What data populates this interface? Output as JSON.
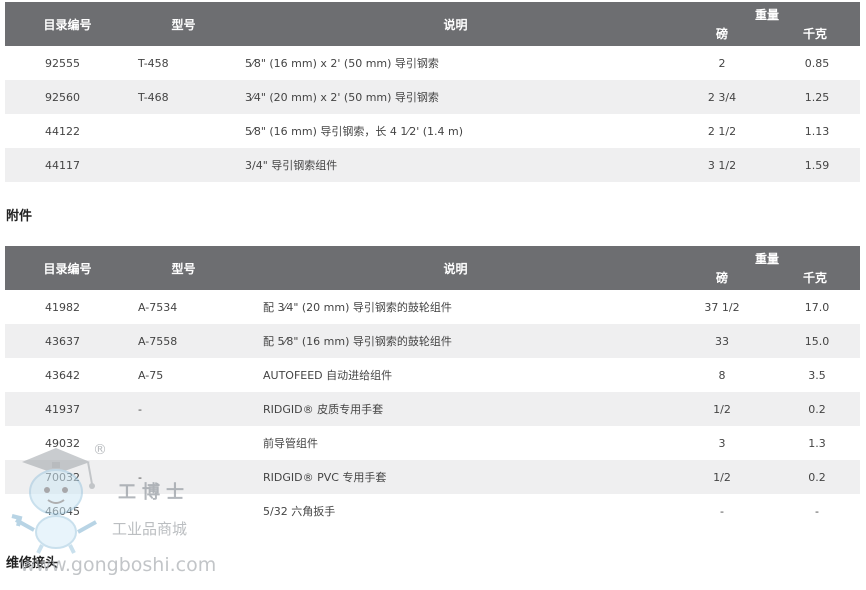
{
  "table1": {
    "headers": {
      "catalog": "目录编号",
      "model": "型号",
      "description": "说明",
      "weight": "重量",
      "lb": "磅",
      "kg": "千克"
    },
    "rows": [
      {
        "catalog": "92555",
        "model": "T-458",
        "description": "5⁄8\" (16 mm) x 2' (50 mm) 导引钢索",
        "lb": "2",
        "kg": "0.85"
      },
      {
        "catalog": "92560",
        "model": "T-468",
        "description": "3⁄4\" (20 mm) x 2' (50 mm) 导引钢索",
        "lb": "2 3/4",
        "kg": "1.25"
      },
      {
        "catalog": "44122",
        "model": "",
        "description": "5⁄8\" (16 mm) 导引钢索，长 4 1⁄2' (1.4 m)",
        "lb": "2 1/2",
        "kg": "1.13"
      },
      {
        "catalog": "44117",
        "model": "",
        "description": "3/4\" 导引钢索组件",
        "lb": "3 1/2",
        "kg": "1.59"
      }
    ]
  },
  "section_attachments": "附件",
  "table2": {
    "headers": {
      "catalog": "目录编号",
      "model": "型号",
      "description": "说明",
      "weight": "重量",
      "lb": "磅",
      "kg": "千克"
    },
    "rows": [
      {
        "catalog": "41982",
        "model": "A-7534",
        "description": "配 3⁄4\" (20 mm) 导引钢索的鼓轮组件",
        "lb": "37 1/2",
        "kg": "17.0"
      },
      {
        "catalog": "43637",
        "model": "A-7558",
        "description": "配 5⁄8\" (16 mm) 导引钢索的鼓轮组件",
        "lb": "33",
        "kg": "15.0"
      },
      {
        "catalog": "43642",
        "model": "A-75",
        "description": "AUTOFEED 自动进给组件",
        "lb": "8",
        "kg": "3.5"
      },
      {
        "catalog": "41937",
        "model": "-",
        "description": "RIDGID® 皮质专用手套",
        "lb": "1/2",
        "kg": "0.2"
      },
      {
        "catalog": "49032",
        "model": "",
        "description": "前导管组件",
        "lb": "3",
        "kg": "1.3"
      },
      {
        "catalog": "70032",
        "model": "-",
        "description": "RIDGID® PVC 专用手套",
        "lb": "1/2",
        "kg": "0.2"
      },
      {
        "catalog": "46045",
        "model": "",
        "description": "5/32 六角扳手",
        "lb": "-",
        "kg": "-"
      }
    ]
  },
  "section_repair": "维修接头",
  "watermark": {
    "brand": "工博士",
    "subtitle": "工业品商城",
    "url": "www.gongboshi.com",
    "registered": "®"
  }
}
